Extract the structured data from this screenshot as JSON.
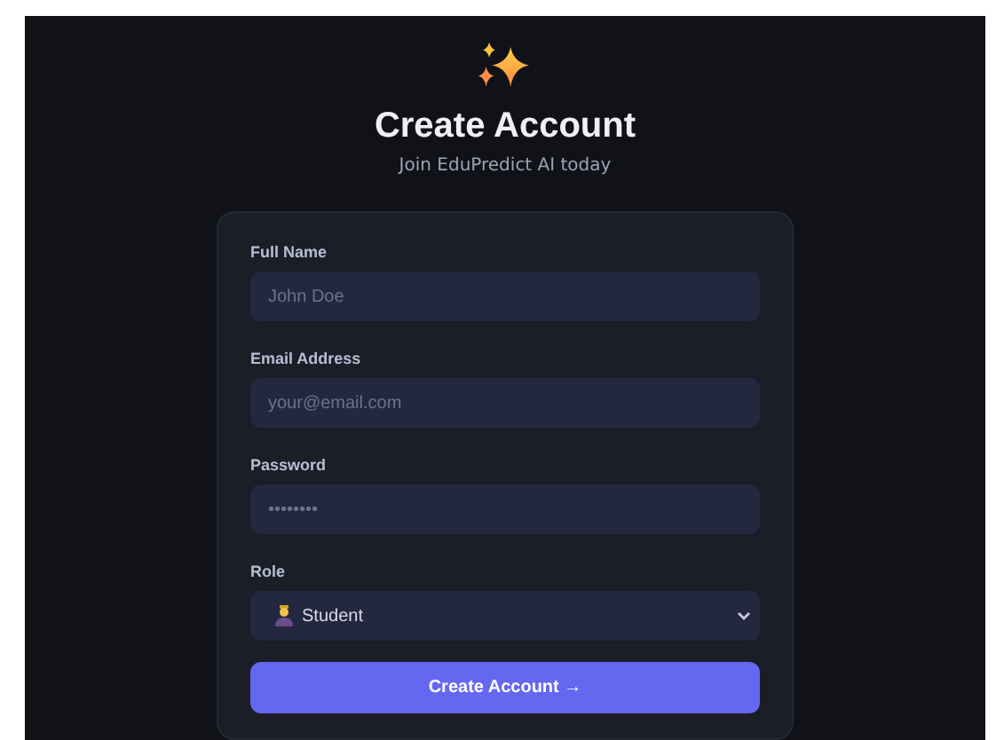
{
  "header": {
    "title": "Create Account",
    "subtitle": "Join EduPredict AI today"
  },
  "form": {
    "fields": [
      {
        "label": "Full Name",
        "kind": "text",
        "placeholder": "John Doe"
      },
      {
        "label": "Email Address",
        "kind": "email",
        "placeholder": "your@email.com"
      },
      {
        "label": "Password",
        "kind": "password",
        "placeholder": "••••••••"
      },
      {
        "label": "Role",
        "kind": "select",
        "value": "Student"
      }
    ],
    "submit": "Create Account →"
  }
}
